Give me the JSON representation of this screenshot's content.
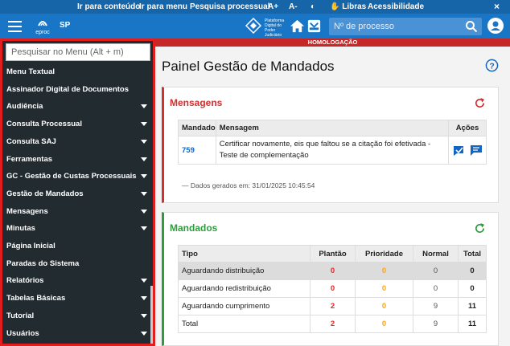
{
  "accessibility_bar": {
    "items": [
      "Ir para conteúdo",
      "Ir para menu",
      "Pesquisa processual",
      "A+",
      "A-",
      "◐",
      "Libras",
      "Acessibilidade"
    ],
    "close": "×"
  },
  "header": {
    "logo_text": "eproc",
    "state": "SP",
    "tj_logo_text": "Plataforma Digital do Poder Judiciário",
    "search_placeholder": "Nº de processo"
  },
  "sidebar": {
    "search_placeholder": "Pesquisar no Menu (Alt + m)",
    "items": [
      {
        "label": "Menu Textual",
        "expandable": false
      },
      {
        "label": "Assinador Digital de Documentos",
        "expandable": false
      },
      {
        "label": "Audiência",
        "expandable": true
      },
      {
        "label": "Consulta Processual",
        "expandable": true
      },
      {
        "label": "Consulta SAJ",
        "expandable": true
      },
      {
        "label": "Ferramentas",
        "expandable": true
      },
      {
        "label": "GC - Gestão de Custas Processuais",
        "expandable": true
      },
      {
        "label": "Gestão de Mandados",
        "expandable": true
      },
      {
        "label": "Mensagens",
        "expandable": true
      },
      {
        "label": "Minutas",
        "expandable": true
      },
      {
        "label": "Página Inicial",
        "expandable": false
      },
      {
        "label": "Paradas do Sistema",
        "expandable": false
      },
      {
        "label": "Relatórios",
        "expandable": true
      },
      {
        "label": "Tabelas Básicas",
        "expandable": true
      },
      {
        "label": "Tutorial",
        "expandable": true
      },
      {
        "label": "Usuários",
        "expandable": true
      }
    ]
  },
  "banner": "HOMOLOGAÇÃO",
  "main": {
    "title": "Painel Gestão de Mandados",
    "messages_card": {
      "title": "Mensagens",
      "columns": [
        "Mandado",
        "Mensagem",
        "Ações"
      ],
      "rows": [
        {
          "mandado": "759",
          "mensagem": "Certificar novamente, eis que faltou se a citação foi efetivada - Teste de complementação"
        }
      ],
      "generated": "— Dados gerados em: 31/01/2025 10:45:54"
    },
    "mandados_card": {
      "title": "Mandados",
      "columns": [
        "Tipo",
        "Plantão",
        "Prioridade",
        "Normal",
        "Total"
      ],
      "rows": [
        {
          "tipo": "Aguardando distribuição",
          "plantao": "0",
          "prioridade": "0",
          "normal": "0",
          "total": "0"
        },
        {
          "tipo": "Aguardando redistribuição",
          "plantao": "0",
          "prioridade": "0",
          "normal": "0",
          "total": "0"
        },
        {
          "tipo": "Aguardando cumprimento",
          "plantao": "2",
          "prioridade": "0",
          "normal": "9",
          "total": "11"
        },
        {
          "tipo": "Total",
          "plantao": "2",
          "prioridade": "0",
          "normal": "9",
          "total": "11"
        }
      ]
    }
  },
  "colors": {
    "header_blue": "#1976c6",
    "accessibility_blue": "#1565a8",
    "sidebar_bg": "#222b30",
    "highlight_border": "#e11d1d",
    "messages_accent": "#d32f2f",
    "mandados_accent": "#2e9b3e",
    "banner_red": "#c62828"
  }
}
